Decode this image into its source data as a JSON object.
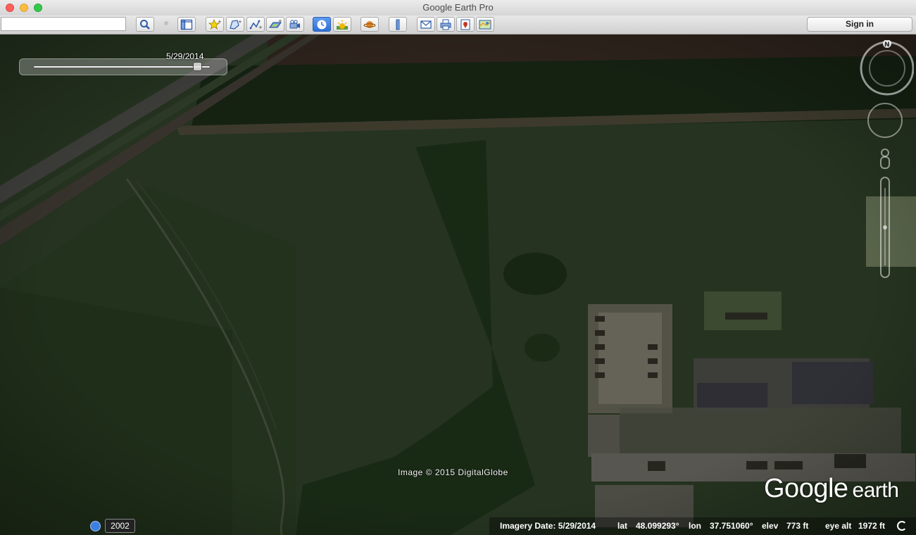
{
  "window": {
    "title": "Google Earth Pro"
  },
  "toolbar": {
    "search": {
      "value": "",
      "placeholder": ""
    },
    "buttons": [
      {
        "name": "search-panel-button",
        "icon": "magnifier-icon"
      },
      {
        "name": "sidebar-toggle-button",
        "icon": "sidebar-icon"
      },
      {
        "name": "add-placemark-button",
        "icon": "placemark-icon"
      },
      {
        "name": "add-polygon-button",
        "icon": "polygon-icon"
      },
      {
        "name": "add-path-button",
        "icon": "path-icon"
      },
      {
        "name": "add-image-overlay-button",
        "icon": "image-overlay-icon"
      },
      {
        "name": "record-tour-button",
        "icon": "record-tour-icon"
      },
      {
        "name": "historical-imagery-button",
        "icon": "clock-icon",
        "active": true
      },
      {
        "name": "sunlight-button",
        "icon": "sun-icon"
      },
      {
        "name": "switch-planet-button",
        "icon": "planet-icon"
      },
      {
        "name": "ruler-button",
        "icon": "ruler-icon"
      },
      {
        "name": "email-button",
        "icon": "envelope-icon"
      },
      {
        "name": "print-button",
        "icon": "printer-icon"
      },
      {
        "name": "save-image-button",
        "icon": "save-image-icon"
      },
      {
        "name": "view-in-maps-button",
        "icon": "maps-icon"
      }
    ],
    "sign_in_label": "Sign in"
  },
  "map": {
    "time_slider_date": "5/29/2014",
    "time_slider_position": 0.95,
    "copyright": "Image © 2015 DigitalGlobe",
    "logo": {
      "brand": "Google",
      "product": "earth"
    },
    "compass_label": "N"
  },
  "status": {
    "year": "2002",
    "imagery_date_label": "Imagery Date: 5/29/2014",
    "lat_label": "lat",
    "lat_value": "48.099293°",
    "lon_label": "lon",
    "lon_value": "37.751060°",
    "elev_label": "elev",
    "elev_value": "773 ft",
    "eye_alt_label": "eye alt",
    "eye_alt_value": "1972 ft"
  },
  "colors": {
    "active_button": "#2f6fd8",
    "field_dark": "#1c2718",
    "field_light": "#2a3a22",
    "road": "#4a4a4a"
  }
}
